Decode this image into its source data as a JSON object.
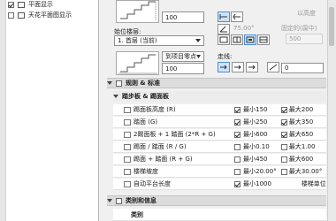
{
  "left_panel": {
    "items": [
      {
        "label": "平面显示"
      },
      {
        "label": "天花平面图显示"
      }
    ]
  },
  "top": {
    "upper_value": "100",
    "angle_value": "75.00°",
    "right_label_top": "以高度",
    "fixed_label": "固定的(腐中)",
    "fixed_value": "500",
    "home_story_label": "始位楼层:",
    "home_story_value": "1. 首层 (当前)",
    "offset_label": "到项目零点",
    "lower_value": "100",
    "walking_line_label": "走线:",
    "walking_line_value": "0"
  },
  "sections": {
    "rules": "规则 & 标准",
    "stairs_group": "踏步板 & 踢面板",
    "category": "类别和信息",
    "category_sub": "类别"
  },
  "rows": [
    {
      "name": "踢面板高度 (R)",
      "c1": true,
      "t1": "最小",
      "v1": "150",
      "c2": true,
      "t2": "最大",
      "v2": "200"
    },
    {
      "name": "踏面 (G)",
      "c1": true,
      "t1": "最小",
      "v1": "250",
      "c2": true,
      "t2": "最大",
      "v2": "350"
    },
    {
      "name": "2踢面板 + 1 踏面 (2*R + G)",
      "c1": true,
      "t1": "最小",
      "v1": "600",
      "c2": true,
      "t2": "最大",
      "v2": "650"
    },
    {
      "name": "踢面 / 踏面 (R / G)",
      "c1": false,
      "t1": "最小",
      "v1": "0.10",
      "c2": false,
      "t2": "最大",
      "v2": "1.00"
    },
    {
      "name": "踢面 + 踏面 (R + G)",
      "c1": false,
      "t1": "最小",
      "v1": "450",
      "c2": false,
      "t2": "最大",
      "v2": "600"
    },
    {
      "name": "楼梯坡度",
      "c1": false,
      "t1": "最小",
      "v1": "20.00°",
      "c2": false,
      "t2": "最大",
      "v2": "30.00°"
    },
    {
      "name": "自动平台长度",
      "c1": true,
      "t1": "最小",
      "v1": "1000",
      "c2": false,
      "t2": "",
      "v2": "楼梯单位"
    }
  ]
}
